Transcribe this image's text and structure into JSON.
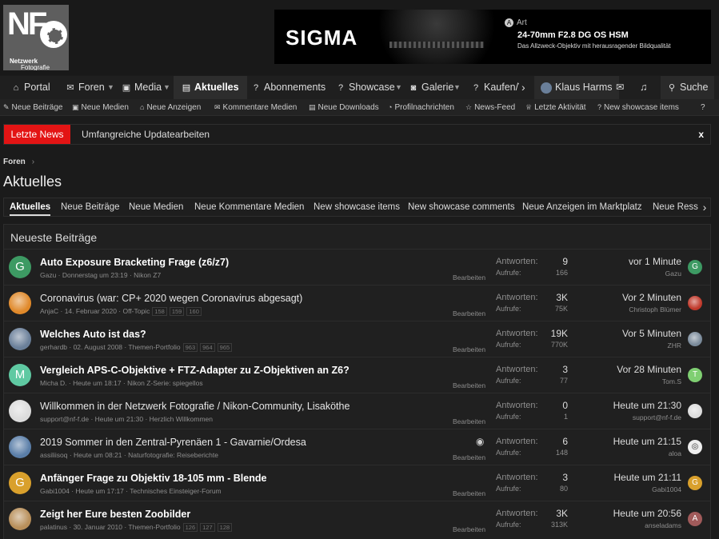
{
  "logo": {
    "letters": "NF",
    "line1": "Netzwerk",
    "line2": "Fotografie"
  },
  "banner": {
    "brand": "SIGMA",
    "art_badge": "A",
    "art": "Art",
    "model": "24-70mm F2.8 DG OS HSM",
    "tagline": "Das Allzweck-Objektiv mit herausragender Bildqualität"
  },
  "nav": {
    "portal": "Portal",
    "foren": "Foren",
    "media": "Media",
    "aktuelles": "Aktuelles",
    "abonnements": "Abonnements",
    "showcase": "Showcase",
    "galerie": "Galerie",
    "kaufen": "Kaufen/V",
    "user": "Klaus Harms",
    "search": "Suche"
  },
  "subnav": [
    "Neue Beiträge",
    "Neue Medien",
    "Neue Anzeigen",
    "Kommentare Medien",
    "Neue Downloads",
    "Profilnachrichten",
    "News-Feed",
    "Letzte Aktivität",
    "New showcase items"
  ],
  "news": {
    "label": "Letzte News",
    "text": "Umfangreiche Updatearbeiten",
    "close": "x"
  },
  "breadcrumb": {
    "item": "Foren",
    "sep": "›"
  },
  "page_title": "Aktuelles",
  "tabs": [
    "Aktuelles",
    "Neue Beiträge",
    "Neue Medien",
    "Neue Kommentare Medien",
    "New showcase items",
    "New showcase comments",
    "Neue Anzeigen im Marktplatz",
    "Neue Ress"
  ],
  "block_title": "Neueste Beiträge",
  "labels": {
    "replies": "Antworten:",
    "views": "Aufrufe:",
    "edit": "Bearbeiten"
  },
  "threads": [
    {
      "avatar": "G",
      "avatar_color": "#3d9a63",
      "title": "Auto Exposure Bracketing Frage (z6/z7)",
      "bold": true,
      "meta": "Gazu · Donnerstag um 23:19 · Nikon Z7",
      "pages": [],
      "replies": "9",
      "views": "166",
      "last_time": "vor 1 Minute",
      "last_user": "Gazu",
      "last_avatar": "G",
      "last_color": "#3d9a63"
    },
    {
      "avatar": "",
      "avatar_color": "#e0892a",
      "title": "Coronavirus (war: CP+ 2020 wegen Coronavirus abgesagt)",
      "bold": false,
      "meta": "AnjaC · 14. Februar 2020 · Off-Topic",
      "pages": [
        "158",
        "159",
        "160"
      ],
      "replies": "3K",
      "views": "75K",
      "last_time": "Vor 2 Minuten",
      "last_user": "Christoph Blümer",
      "last_avatar": "",
      "last_color": "#c0392b"
    },
    {
      "avatar": "",
      "avatar_color": "#6a7f99",
      "title": "Welches Auto ist das?",
      "bold": true,
      "meta": "gerhardb · 02. August 2008 · Themen-Portfolio",
      "pages": [
        "963",
        "964",
        "965"
      ],
      "replies": "19K",
      "views": "770K",
      "last_time": "Vor 5 Minuten",
      "last_user": "ZHR",
      "last_avatar": "",
      "last_color": "#7a8a9a"
    },
    {
      "avatar": "M",
      "avatar_color": "#5fc9a2",
      "title": "Vergleich APS-C-Objektive + FTZ-Adapter zu Z-Objektiven an Z6?",
      "bold": true,
      "meta": "Micha D. · Heute um 18:17 · Nikon Z-Serie: spiegellos",
      "pages": [],
      "replies": "3",
      "views": "77",
      "last_time": "Vor 28 Minuten",
      "last_user": "Tom.S",
      "last_avatar": "T",
      "last_color": "#7fcf72"
    },
    {
      "avatar": "",
      "avatar_color": "#dcdcdc",
      "title": "Willkommen in der Netzwerk Fotografie / Nikon-Community, Lisaköthe",
      "bold": false,
      "meta": "support@nf-f.de · Heute um 21:30 · Herzlich Willkommen",
      "pages": [],
      "replies": "0",
      "views": "1",
      "last_time": "Heute um 21:30",
      "last_user": "support@nf-f.de",
      "last_avatar": "",
      "last_color": "#dcdcdc"
    },
    {
      "avatar": "",
      "avatar_color": "#5a7ea8",
      "title": "2019 Sommer in den Zentral-Pyrenäen 1 - Gavarnie/Ordesa",
      "bold": false,
      "meta": "assiliisoq · Heute um 08:21 · Naturfotografie: Reiseberichte",
      "pages": [],
      "replies": "6",
      "views": "148",
      "last_time": "Heute um 21:15",
      "last_user": "aloa",
      "last_avatar": "◎",
      "last_color": "#eeeeee"
    },
    {
      "avatar": "G",
      "avatar_color": "#d9a02c",
      "title": "Anfänger Frage zu Objektiv 18-105 mm - Blende",
      "bold": true,
      "meta": "Gabi1004 · Heute um 17:17 · Technisches Einsteiger-Forum",
      "pages": [],
      "replies": "3",
      "views": "80",
      "last_time": "Heute um 21:11",
      "last_user": "Gabi1004",
      "last_avatar": "G",
      "last_color": "#d9a02c"
    },
    {
      "avatar": "",
      "avatar_color": "#b88f5a",
      "title": "Zeigt her Eure besten Zoobilder",
      "bold": true,
      "meta": "palatinus · 30. Januar 2010 · Themen-Portfolio",
      "pages": [
        "126",
        "127",
        "128"
      ],
      "replies": "3K",
      "views": "313K",
      "last_time": "Heute um 20:56",
      "last_user": "anseladams",
      "last_avatar": "A",
      "last_color": "#a05a5a"
    }
  ]
}
